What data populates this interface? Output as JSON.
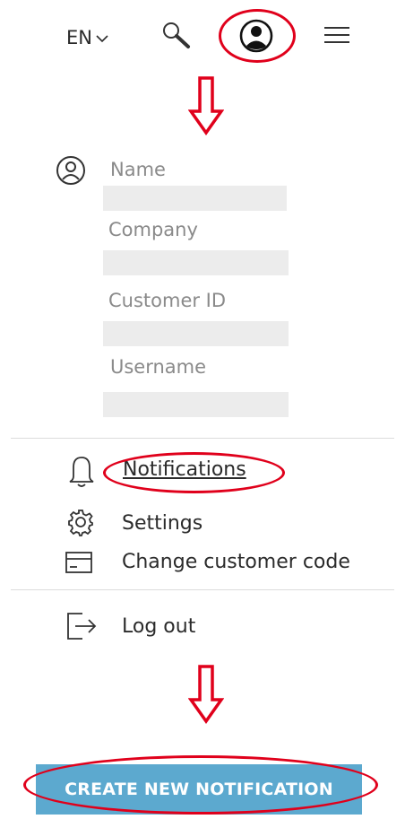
{
  "header": {
    "language": "EN",
    "icons": [
      "chevron-down-icon",
      "search-icon",
      "user-icon",
      "hamburger-menu-icon"
    ]
  },
  "profile": {
    "fields": [
      {
        "label": "Name",
        "value": ""
      },
      {
        "label": "Company",
        "value": ""
      },
      {
        "label": "Customer ID",
        "value": ""
      },
      {
        "label": "Username",
        "value": ""
      }
    ]
  },
  "menu": {
    "items": [
      {
        "label": "Notifications",
        "icon": "bell-icon"
      },
      {
        "label": "Settings",
        "icon": "gear-icon"
      },
      {
        "label": "Change customer code",
        "icon": "card-icon"
      }
    ],
    "logout": {
      "label": "Log out",
      "icon": "logout-icon"
    }
  },
  "cta": {
    "label": "CREATE NEW NOTIFICATION"
  },
  "colors": {
    "annotation": "#e0001b",
    "cta_background": "#5ca9cf",
    "placeholder_bar": "#ececec"
  }
}
